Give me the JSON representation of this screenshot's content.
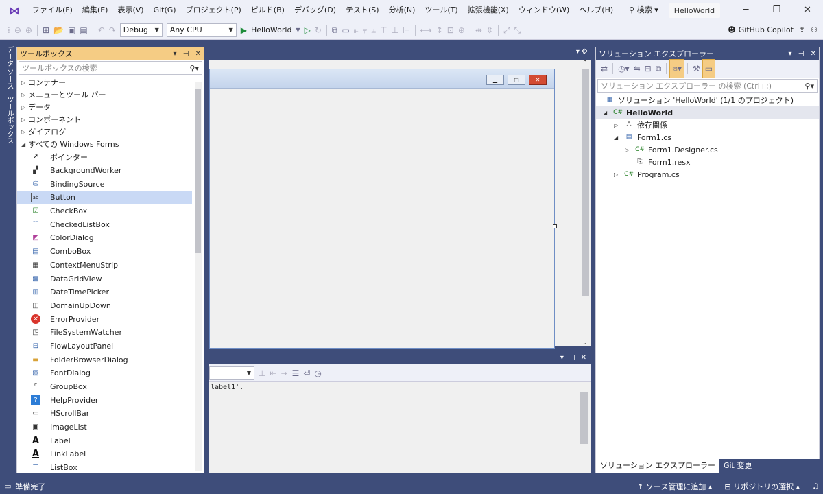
{
  "menubar": {
    "items": [
      "ファイル(F)",
      "編集(E)",
      "表示(V)",
      "Git(G)",
      "プロジェクト(P)",
      "ビルド(B)",
      "デバッグ(D)",
      "テスト(S)",
      "分析(N)",
      "ツール(T)",
      "拡張機能(X)",
      "ウィンドウ(W)",
      "ヘルプ(H)"
    ],
    "search_label": "検索",
    "solution_name": "HelloWorld"
  },
  "toolbar": {
    "config": "Debug",
    "platform": "Any CPU",
    "run_target": "HelloWorld",
    "copilot_label": "GitHub Copilot"
  },
  "sidetabs": {
    "datasource": "データ ソース",
    "toolbox": "ツールボックス"
  },
  "toolbox": {
    "title": "ツールボックス",
    "search_placeholder": "ツールボックスの検索",
    "categories": [
      "コンテナー",
      "メニューとツール バー",
      "データ",
      "コンポーネント",
      "ダイアログ",
      "すべての Windows Forms"
    ],
    "items": [
      "ポインター",
      "BackgroundWorker",
      "BindingSource",
      "Button",
      "CheckBox",
      "CheckedListBox",
      "ColorDialog",
      "ComboBox",
      "ContextMenuStrip",
      "DataGridView",
      "DateTimePicker",
      "DomainUpDown",
      "ErrorProvider",
      "FileSystemWatcher",
      "FlowLayoutPanel",
      "FolderBrowserDialog",
      "FontDialog",
      "GroupBox",
      "HelpProvider",
      "HScrollBar",
      "ImageList",
      "Label",
      "LinkLabel",
      "ListBox"
    ],
    "selected_item": "Button"
  },
  "output": {
    "text": "label1'."
  },
  "solution": {
    "title": "ソリューション エクスプローラー",
    "search_placeholder": "ソリューション エクスプローラー の検索 (Ctrl+;)",
    "root": "ソリューション 'HelloWorld' (1/1 のプロジェクト)",
    "project": "HelloWorld",
    "dependencies": "依存関係",
    "form1": "Form1.cs",
    "designer": "Form1.Designer.cs",
    "resx": "Form1.resx",
    "program": "Program.cs",
    "tab_solution": "ソリューション エクスプローラー",
    "tab_git": "Git 変更"
  },
  "statusbar": {
    "status": "準備完了",
    "source_control": "ソース管理に追加",
    "repo": "リポジトリの選択"
  },
  "colors": {
    "accent": "#3e4d7a",
    "toolbox_title": "#f5cc84",
    "selection": "#c9d9f5"
  }
}
